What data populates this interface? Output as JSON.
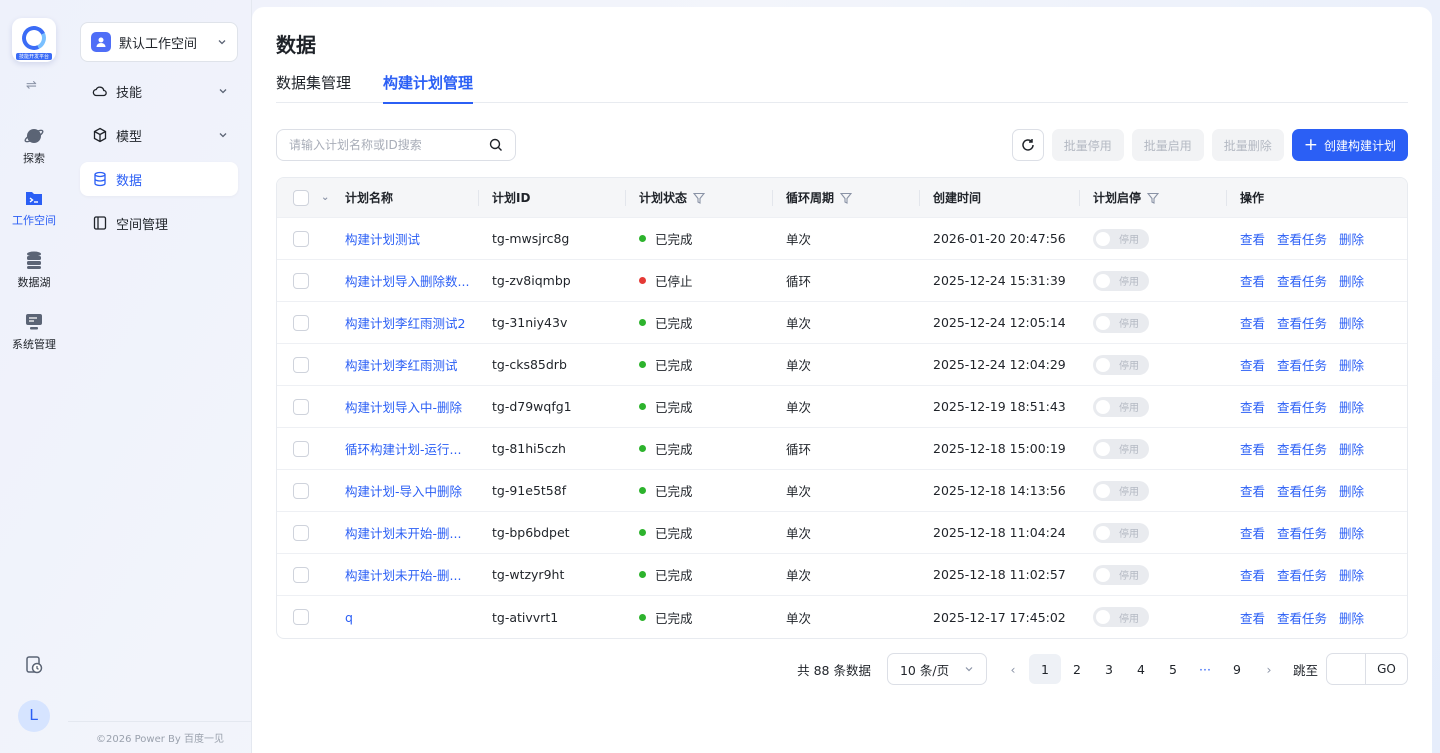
{
  "rail": {
    "logo_caption": "技能开发平台",
    "items": [
      {
        "label": "探索",
        "icon": "planet-icon"
      },
      {
        "label": "工作空间",
        "icon": "terminal-folder-icon"
      },
      {
        "label": "数据湖",
        "icon": "database-icon"
      },
      {
        "label": "系统管理",
        "icon": "server-icon"
      }
    ],
    "avatar_letter": "L"
  },
  "nav": {
    "workspace": "默认工作空间",
    "items": [
      {
        "label": "技能"
      },
      {
        "label": "模型"
      },
      {
        "label": "数据"
      },
      {
        "label": "空间管理"
      }
    ],
    "copyright": "©2026 Power By 百度一见"
  },
  "page": {
    "title": "数据",
    "tabs": [
      {
        "label": "数据集管理"
      },
      {
        "label": "构建计划管理"
      }
    ],
    "search_placeholder": "请输入计划名称或ID搜索",
    "toolbar": {
      "batch_stop": "批量停用",
      "batch_start": "批量启用",
      "batch_delete": "批量删除",
      "create": "创建构建计划"
    },
    "colors": {
      "accent": "#2b5ff5",
      "done": "#2db32d",
      "stopped": "#e53935"
    }
  },
  "table": {
    "headers": {
      "name": "计划名称",
      "id": "计划ID",
      "status": "计划状态",
      "cycle": "循环周期",
      "time": "创建时间",
      "toggle": "计划启停",
      "ops": "操作"
    },
    "rows": [
      {
        "name": "构建计划测试",
        "id": "tg-mwsjrc8g",
        "status": "已完成",
        "cycle": "单次",
        "time": "2026-01-20 20:47:56",
        "toggle": "停用"
      },
      {
        "name": "构建计划导入删除数...",
        "id": "tg-zv8iqmbp",
        "status": "已停止",
        "cycle": "循环",
        "time": "2025-12-24 15:31:39",
        "toggle": "停用"
      },
      {
        "name": "构建计划李红雨测试2",
        "id": "tg-31niy43v",
        "status": "已完成",
        "cycle": "单次",
        "time": "2025-12-24 12:05:14",
        "toggle": "停用"
      },
      {
        "name": "构建计划李红雨测试",
        "id": "tg-cks85drb",
        "status": "已完成",
        "cycle": "单次",
        "time": "2025-12-24 12:04:29",
        "toggle": "停用"
      },
      {
        "name": "构建计划导入中-删除",
        "id": "tg-d79wqfg1",
        "status": "已完成",
        "cycle": "单次",
        "time": "2025-12-19 18:51:43",
        "toggle": "停用"
      },
      {
        "name": "循环构建计划-运行...",
        "id": "tg-81hi5czh",
        "status": "已完成",
        "cycle": "循环",
        "time": "2025-12-18 15:00:19",
        "toggle": "停用"
      },
      {
        "name": "构建计划-导入中删除",
        "id": "tg-91e5t58f",
        "status": "已完成",
        "cycle": "单次",
        "time": "2025-12-18 14:13:56",
        "toggle": "停用"
      },
      {
        "name": "构建计划未开始-删...",
        "id": "tg-bp6bdpet",
        "status": "已完成",
        "cycle": "单次",
        "time": "2025-12-18 11:04:24",
        "toggle": "停用"
      },
      {
        "name": "构建计划未开始-删...",
        "id": "tg-wtzyr9ht",
        "status": "已完成",
        "cycle": "单次",
        "time": "2025-12-18 11:02:57",
        "toggle": "停用"
      },
      {
        "name": "q",
        "id": "tg-ativvrt1",
        "status": "已完成",
        "cycle": "单次",
        "time": "2025-12-17 17:45:02",
        "toggle": "停用"
      }
    ],
    "ops": {
      "view": "查看",
      "view_tasks": "查看任务",
      "delete": "删除"
    }
  },
  "pager": {
    "total": "共 88 条数据",
    "size": "10 条/页",
    "pages": [
      "1",
      "2",
      "3",
      "4",
      "5",
      "···",
      "9"
    ],
    "current": "1",
    "jump_label": "跳至",
    "go": "GO"
  }
}
